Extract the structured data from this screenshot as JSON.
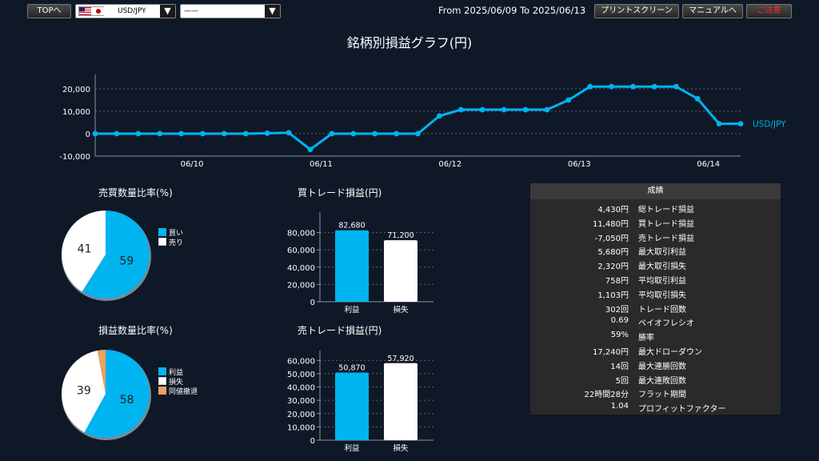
{
  "toolbar": {
    "top_label": "TOPへ",
    "pair_select_value": "USD/JPY",
    "second_select_value": "——",
    "date_range": "From 2025/06/09 To 2025/06/13",
    "print_label": "プリントスクリーン",
    "manual_label": "マニュアルへ",
    "close_label": "ご注意"
  },
  "colors": {
    "accent": "#00b4f0",
    "background": "#0f1827",
    "panel": "#2a2a2a",
    "close_text": "#ff2a2a",
    "draw_color": "#f0a060"
  },
  "main_title": "銘柄別損益グラフ(円)",
  "chart_data": [
    {
      "type": "line",
      "series_label": "USD/JPY",
      "y": [
        0,
        0,
        0,
        0,
        0,
        0,
        0,
        0,
        200,
        400,
        -7050,
        0,
        0,
        0,
        0,
        0,
        7900,
        10700,
        10700,
        10700,
        10700,
        10700,
        15000,
        21000,
        21000,
        21000,
        21000,
        21000,
        15600,
        4430,
        4430
      ],
      "x_tick_labels": [
        "06/10",
        "06/11",
        "06/12",
        "06/13",
        "06/14"
      ],
      "y_tick_labels": [
        "20,000",
        "10,000",
        "0",
        "-10,000"
      ],
      "ylim": [
        -10000,
        25000
      ],
      "grid": true
    },
    {
      "type": "pie",
      "title": "売買数量比率(%)",
      "slices": [
        {
          "label": "買い",
          "value": 59,
          "color": "#00b4f0"
        },
        {
          "label": "売り",
          "value": 41,
          "color": "#ffffff"
        }
      ]
    },
    {
      "type": "pie",
      "title": "損益数量比率(%)",
      "slices": [
        {
          "label": "利益",
          "value": 58,
          "color": "#00b4f0"
        },
        {
          "label": "損失",
          "value": 39,
          "color": "#ffffff"
        },
        {
          "label": "同値撤退",
          "value": 3,
          "color": "#f0a060"
        }
      ]
    },
    {
      "type": "bar",
      "title": "買トレード損益(円)",
      "categories": [
        "利益",
        "損失"
      ],
      "values": [
        82680,
        71200
      ],
      "value_labels": [
        "82,680",
        "71,200"
      ],
      "colors": [
        "#00b4f0",
        "#ffffff"
      ],
      "y_tick_labels": [
        "80,000",
        "60,000",
        "40,000",
        "20,000",
        "0"
      ],
      "ylim": [
        0,
        100000
      ]
    },
    {
      "type": "bar",
      "title": "売トレード損益(円)",
      "categories": [
        "利益",
        "損失"
      ],
      "values": [
        50870,
        57920
      ],
      "value_labels": [
        "50,870",
        "57,920"
      ],
      "colors": [
        "#00b4f0",
        "#ffffff"
      ],
      "y_tick_labels": [
        "60,000",
        "50,000",
        "40,000",
        "30,000",
        "20,000",
        "10,000",
        "0"
      ],
      "ylim": [
        0,
        65000
      ]
    }
  ],
  "stats": {
    "header": "成績",
    "rows": [
      {
        "value": "4,430円",
        "label": "総トレード損益"
      },
      {
        "value": "11,480円",
        "label": "買トレード損益"
      },
      {
        "value": "-7,050円",
        "label": "売トレード損益"
      },
      {
        "value": "5,680円",
        "label": "最大取引利益"
      },
      {
        "value": "2,320円",
        "label": "最大取引損失"
      },
      {
        "value": "758円",
        "label": "平均取引利益"
      },
      {
        "value": "1,103円",
        "label": "平均取引損失"
      },
      {
        "value": "302回",
        "label": "トレード回数"
      },
      {
        "value": "0.69",
        "label": "ペイオフレシオ"
      },
      {
        "value": "59%",
        "label": "勝率"
      },
      {
        "value": "17,240円",
        "label": "最大ドローダウン"
      },
      {
        "value": "14回",
        "label": "最大連勝回数"
      },
      {
        "value": "5回",
        "label": "最大連敗回数"
      },
      {
        "value": "22時間28分",
        "label": "フラット期間"
      },
      {
        "value": "1.04",
        "label": "プロフィットファクター"
      }
    ]
  }
}
